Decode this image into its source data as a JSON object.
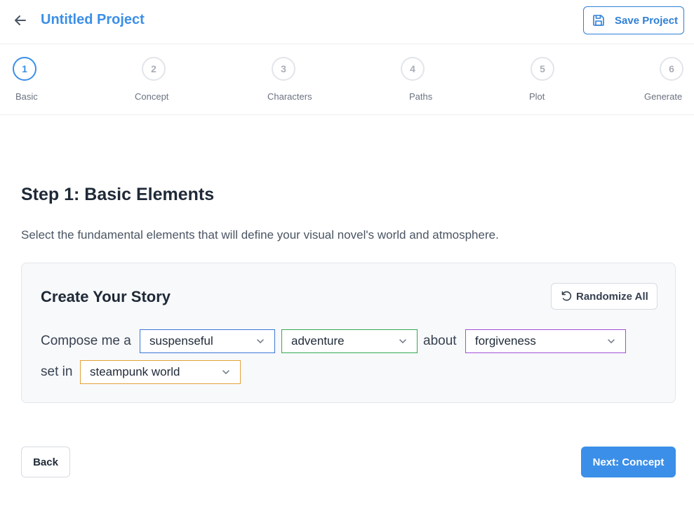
{
  "header": {
    "title": "Untitled Project",
    "save_label": "Save Project"
  },
  "stepper": {
    "steps": [
      {
        "number": "1",
        "label": "Basic",
        "active": true
      },
      {
        "number": "2",
        "label": "Concept",
        "active": false
      },
      {
        "number": "3",
        "label": "Characters",
        "active": false
      },
      {
        "number": "4",
        "label": "Paths",
        "active": false
      },
      {
        "number": "5",
        "label": "Plot",
        "active": false
      },
      {
        "number": "6",
        "label": "Generate",
        "active": false
      }
    ]
  },
  "main": {
    "title": "Step 1: Basic Elements",
    "description": "Select the fundamental elements that will define your visual novel's world and atmosphere."
  },
  "story_card": {
    "title": "Create Your Story",
    "randomize_label": "Randomize All",
    "prefix": "Compose me a",
    "about_text": "about",
    "set_in_text": "set in",
    "tone": {
      "value": "suspenseful",
      "color": "#3b78d8"
    },
    "genre": {
      "value": "adventure",
      "color": "#34a853"
    },
    "theme": {
      "value": "forgiveness",
      "color": "#a44fd6"
    },
    "setting": {
      "value": "steampunk world",
      "color": "#e3a23a"
    }
  },
  "footer": {
    "back_label": "Back",
    "next_label": "Next: Concept"
  },
  "colors": {
    "accent": "#3b8fe8",
    "border": "#e3e6ea"
  }
}
